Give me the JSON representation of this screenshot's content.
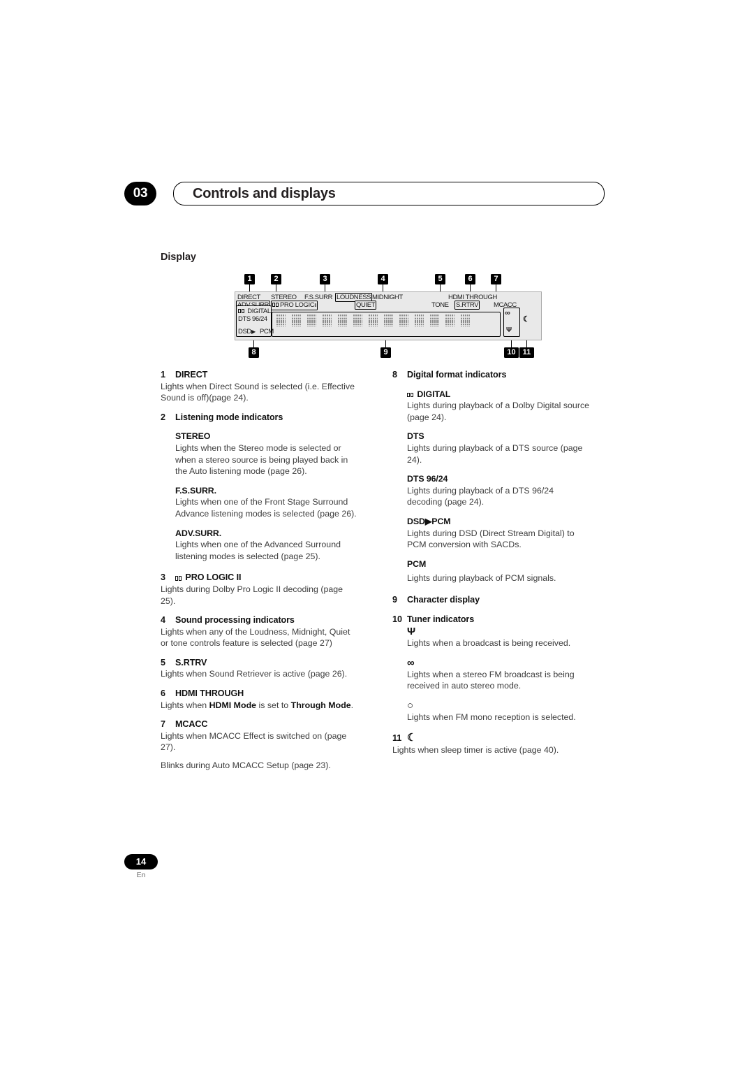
{
  "chapter": {
    "number": "03",
    "title": "Controls and displays"
  },
  "section": {
    "title": "Display"
  },
  "figure": {
    "name": "receiver-front-panel-display",
    "callouts": [
      "1",
      "2",
      "3",
      "4",
      "5",
      "6",
      "7",
      "8",
      "9",
      "10",
      "11"
    ],
    "segments": {
      "direct": "DIRECT",
      "stereo": "STEREO",
      "fs_surr": "F.S.SURR",
      "loudness": "LOUDNESS",
      "midnight": "MIDNIGHT",
      "hdmi_through": "HDMI THROUGH",
      "adv_surr": "ADV.SURR",
      "pro_logic": "PRO LOGIC",
      "pro_logic_sup": "II",
      "quiet": "QUIET",
      "tone": "TONE",
      "s_rtrv": "S.RTRV",
      "mcacc": "MCACC",
      "digital": "DIGITAL",
      "dts_9624": "DTS 96/24",
      "dsd": "DSD",
      "arrow": "▶",
      "pcm": "PCM"
    }
  },
  "left_column": [
    {
      "num": "1",
      "head": "DIRECT",
      "body": "Lights when Direct Sound is selected (i.e. Effective Sound is off)(page 24).",
      "indent": false
    },
    {
      "num": "2",
      "head": "Listening mode indicators",
      "subs": [
        {
          "head": "STEREO",
          "body": "Lights when the Stereo mode is selected or when a stereo source is being played back in the Auto listening mode (page 26)."
        },
        {
          "head": "F.S.SURR.",
          "body": "Lights when one of the Front Stage Surround Advance listening modes is selected (page 26)."
        },
        {
          "head": "ADV.SURR.",
          "body": "Lights when one of the Advanced Surround listening modes is selected (page 25)."
        }
      ]
    },
    {
      "num": "3",
      "head_prefix_icon": "dolby-logo-icon",
      "head": "PRO LOGIC II",
      "body": "Lights during Dolby Pro Logic II decoding (page 25).",
      "indent": false
    },
    {
      "num": "4",
      "head": "Sound processing indicators",
      "body": "Lights when any of the Loudness, Midnight, Quiet or tone controls feature is selected (page 27)",
      "indent": false
    },
    {
      "num": "5",
      "head": "S.RTRV",
      "body": "Lights when Sound Retriever is active (page 26).",
      "indent": false
    },
    {
      "num": "6",
      "head": "HDMI THROUGH",
      "body_parts": [
        "Lights when ",
        "HDMI Mode",
        " is set to ",
        "Through Mode",
        "."
      ],
      "indent": false
    },
    {
      "num": "7",
      "head": "MCACC",
      "body": "Lights when MCACC Effect is switched on (page 27).",
      "body2": "Blinks during Auto MCACC Setup (page 23).",
      "indent": false
    }
  ],
  "right_column": [
    {
      "num": "8",
      "head": "Digital format indicators",
      "subs": [
        {
          "head_prefix_icon": "dolby-logo-icon",
          "head": "DIGITAL",
          "body": "Lights during playback of a Dolby Digital source (page 24)."
        },
        {
          "head": "DTS",
          "body": "Lights during playback of a DTS source (page 24)."
        },
        {
          "head": "DTS 96/24",
          "body": "Lights during playback of a DTS 96/24 decoding (page 24)."
        },
        {
          "head": "DSD▶PCM",
          "body": "Lights during DSD (Direct Stream Digital) to PCM conversion with SACDs."
        },
        {
          "head": "PCM",
          "body": "Lights during playback of PCM signals."
        }
      ]
    },
    {
      "num": "9",
      "head": "Character display"
    },
    {
      "num": "10",
      "head": "Tuner indicators",
      "subs": [
        {
          "glyph": "Ψ",
          "glyph_name": "antenna-signal-icon",
          "body": "Lights when a broadcast is being received."
        },
        {
          "glyph": "∞",
          "glyph_name": "stereo-rings-icon",
          "body": "Lights when a stereo FM broadcast is being received in auto stereo mode."
        },
        {
          "glyph": "○",
          "glyph_name": "mono-circle-icon",
          "body": "Lights when FM mono reception is selected."
        }
      ]
    },
    {
      "num": "11",
      "glyph": "☾",
      "glyph_name": "sleep-timer-moon-icon",
      "body": "Lights when sleep timer is active (page 40)."
    }
  ],
  "footer": {
    "page": "14",
    "lang": "En"
  }
}
